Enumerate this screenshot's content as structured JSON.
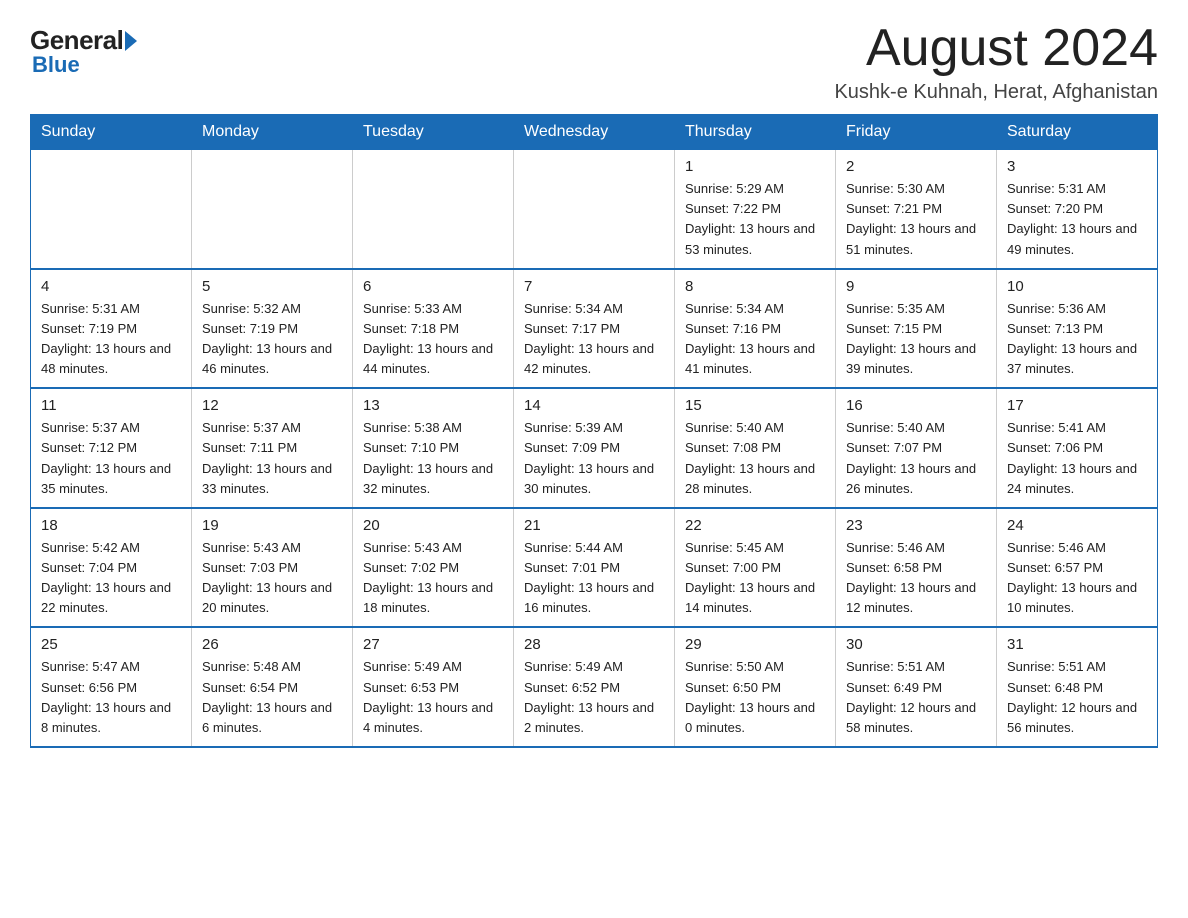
{
  "header": {
    "logo": {
      "general": "General",
      "blue": "Blue"
    },
    "title": "August 2024",
    "location": "Kushk-e Kuhnah, Herat, Afghanistan"
  },
  "calendar": {
    "days_of_week": [
      "Sunday",
      "Monday",
      "Tuesday",
      "Wednesday",
      "Thursday",
      "Friday",
      "Saturday"
    ],
    "weeks": [
      [
        {
          "day": "",
          "info": ""
        },
        {
          "day": "",
          "info": ""
        },
        {
          "day": "",
          "info": ""
        },
        {
          "day": "",
          "info": ""
        },
        {
          "day": "1",
          "info": "Sunrise: 5:29 AM\nSunset: 7:22 PM\nDaylight: 13 hours and 53 minutes."
        },
        {
          "day": "2",
          "info": "Sunrise: 5:30 AM\nSunset: 7:21 PM\nDaylight: 13 hours and 51 minutes."
        },
        {
          "day": "3",
          "info": "Sunrise: 5:31 AM\nSunset: 7:20 PM\nDaylight: 13 hours and 49 minutes."
        }
      ],
      [
        {
          "day": "4",
          "info": "Sunrise: 5:31 AM\nSunset: 7:19 PM\nDaylight: 13 hours and 48 minutes."
        },
        {
          "day": "5",
          "info": "Sunrise: 5:32 AM\nSunset: 7:19 PM\nDaylight: 13 hours and 46 minutes."
        },
        {
          "day": "6",
          "info": "Sunrise: 5:33 AM\nSunset: 7:18 PM\nDaylight: 13 hours and 44 minutes."
        },
        {
          "day": "7",
          "info": "Sunrise: 5:34 AM\nSunset: 7:17 PM\nDaylight: 13 hours and 42 minutes."
        },
        {
          "day": "8",
          "info": "Sunrise: 5:34 AM\nSunset: 7:16 PM\nDaylight: 13 hours and 41 minutes."
        },
        {
          "day": "9",
          "info": "Sunrise: 5:35 AM\nSunset: 7:15 PM\nDaylight: 13 hours and 39 minutes."
        },
        {
          "day": "10",
          "info": "Sunrise: 5:36 AM\nSunset: 7:13 PM\nDaylight: 13 hours and 37 minutes."
        }
      ],
      [
        {
          "day": "11",
          "info": "Sunrise: 5:37 AM\nSunset: 7:12 PM\nDaylight: 13 hours and 35 minutes."
        },
        {
          "day": "12",
          "info": "Sunrise: 5:37 AM\nSunset: 7:11 PM\nDaylight: 13 hours and 33 minutes."
        },
        {
          "day": "13",
          "info": "Sunrise: 5:38 AM\nSunset: 7:10 PM\nDaylight: 13 hours and 32 minutes."
        },
        {
          "day": "14",
          "info": "Sunrise: 5:39 AM\nSunset: 7:09 PM\nDaylight: 13 hours and 30 minutes."
        },
        {
          "day": "15",
          "info": "Sunrise: 5:40 AM\nSunset: 7:08 PM\nDaylight: 13 hours and 28 minutes."
        },
        {
          "day": "16",
          "info": "Sunrise: 5:40 AM\nSunset: 7:07 PM\nDaylight: 13 hours and 26 minutes."
        },
        {
          "day": "17",
          "info": "Sunrise: 5:41 AM\nSunset: 7:06 PM\nDaylight: 13 hours and 24 minutes."
        }
      ],
      [
        {
          "day": "18",
          "info": "Sunrise: 5:42 AM\nSunset: 7:04 PM\nDaylight: 13 hours and 22 minutes."
        },
        {
          "day": "19",
          "info": "Sunrise: 5:43 AM\nSunset: 7:03 PM\nDaylight: 13 hours and 20 minutes."
        },
        {
          "day": "20",
          "info": "Sunrise: 5:43 AM\nSunset: 7:02 PM\nDaylight: 13 hours and 18 minutes."
        },
        {
          "day": "21",
          "info": "Sunrise: 5:44 AM\nSunset: 7:01 PM\nDaylight: 13 hours and 16 minutes."
        },
        {
          "day": "22",
          "info": "Sunrise: 5:45 AM\nSunset: 7:00 PM\nDaylight: 13 hours and 14 minutes."
        },
        {
          "day": "23",
          "info": "Sunrise: 5:46 AM\nSunset: 6:58 PM\nDaylight: 13 hours and 12 minutes."
        },
        {
          "day": "24",
          "info": "Sunrise: 5:46 AM\nSunset: 6:57 PM\nDaylight: 13 hours and 10 minutes."
        }
      ],
      [
        {
          "day": "25",
          "info": "Sunrise: 5:47 AM\nSunset: 6:56 PM\nDaylight: 13 hours and 8 minutes."
        },
        {
          "day": "26",
          "info": "Sunrise: 5:48 AM\nSunset: 6:54 PM\nDaylight: 13 hours and 6 minutes."
        },
        {
          "day": "27",
          "info": "Sunrise: 5:49 AM\nSunset: 6:53 PM\nDaylight: 13 hours and 4 minutes."
        },
        {
          "day": "28",
          "info": "Sunrise: 5:49 AM\nSunset: 6:52 PM\nDaylight: 13 hours and 2 minutes."
        },
        {
          "day": "29",
          "info": "Sunrise: 5:50 AM\nSunset: 6:50 PM\nDaylight: 13 hours and 0 minutes."
        },
        {
          "day": "30",
          "info": "Sunrise: 5:51 AM\nSunset: 6:49 PM\nDaylight: 12 hours and 58 minutes."
        },
        {
          "day": "31",
          "info": "Sunrise: 5:51 AM\nSunset: 6:48 PM\nDaylight: 12 hours and 56 minutes."
        }
      ]
    ]
  }
}
